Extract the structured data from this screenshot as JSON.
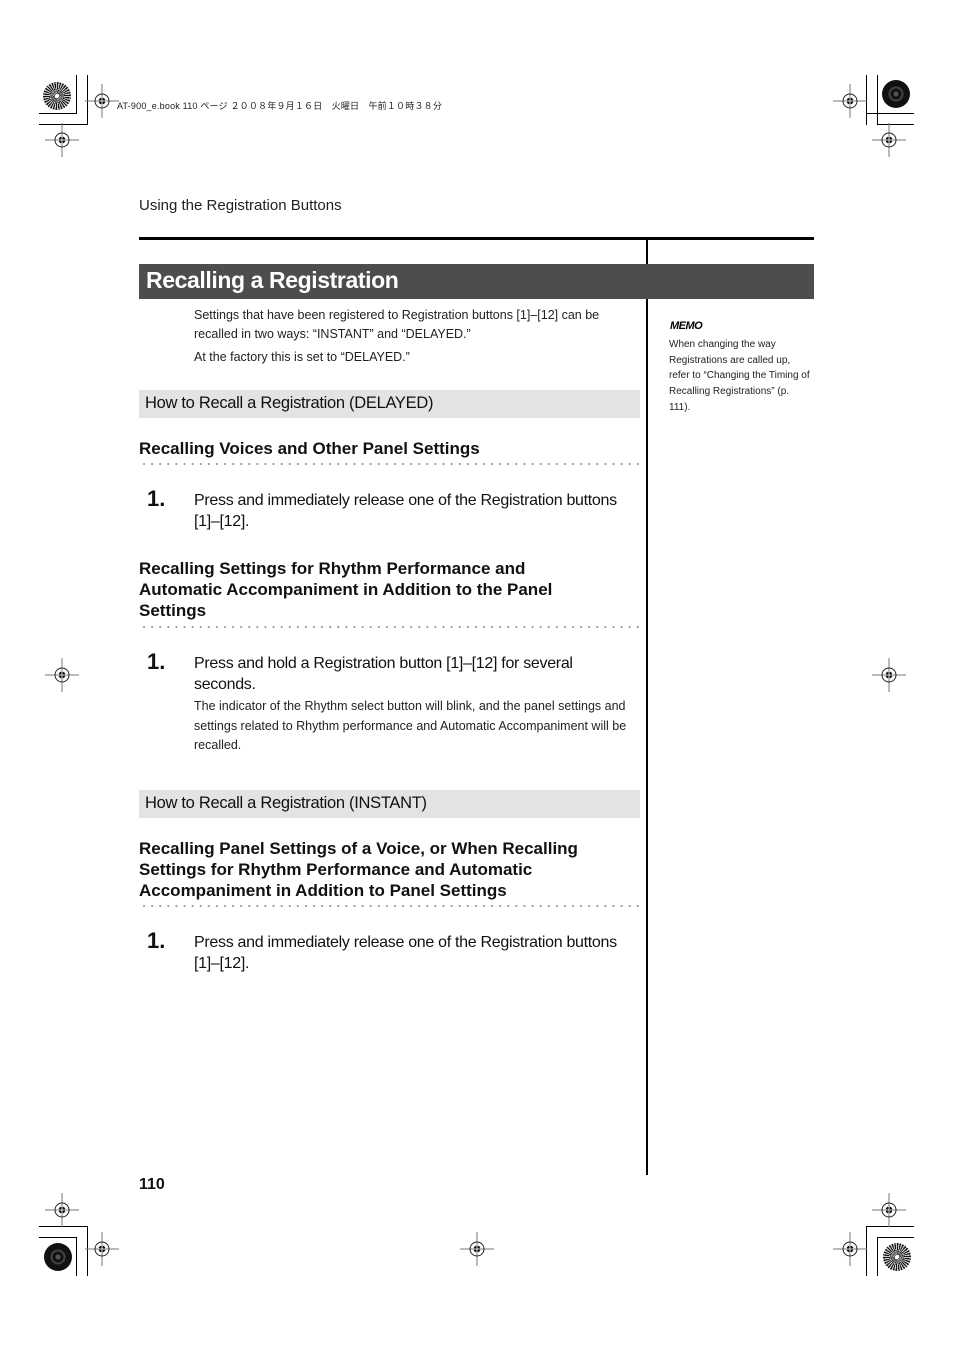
{
  "print_info": {
    "job_line": "AT-900_e.book  110 ページ  ２００８年９月１６日　火曜日　午前１０時３８分"
  },
  "running_head": "Using the Registration Buttons",
  "title": "Recalling a Registration",
  "intro": {
    "paragraph1": "Settings that have been registered to Registration buttons [1]–[12] can be recalled in two ways: “INSTANT” and “DELAYED.”",
    "paragraph2": "At the factory this is set to “DELAYED.”"
  },
  "memo": {
    "icon_label": "MEMO",
    "text": "When changing the way Registrations are called up, refer to “Changing the Timing of Recalling Registrations” (p. 111)."
  },
  "sections": [
    {
      "subhead": "How to Recall a Registration (DELAYED)",
      "groups": [
        {
          "heading": "Recalling Voices and Other Panel Settings",
          "step_number": "1.",
          "step_text": "Press and immediately release one of the Registration buttons [1]–[12].",
          "note": ""
        },
        {
          "heading": "Recalling Settings for Rhythm Performance and Automatic Accompaniment in Addition to the Panel Settings",
          "step_number": "1.",
          "step_text": "Press and hold a Registration button [1]–[12] for several seconds.",
          "note": "The indicator of the Rhythm select button will blink, and the panel settings and settings related to Rhythm performance and Automatic Accompaniment will be recalled."
        }
      ]
    },
    {
      "subhead": "How to Recall a Registration (INSTANT)",
      "groups": [
        {
          "heading": "Recalling Panel Settings of a Voice, or When Recalling Settings for Rhythm Performance and Automatic Accompaniment in Addition to Panel Settings",
          "step_number": "1.",
          "step_text": "Press and immediately release one of the Registration buttons [1]–[12].",
          "note": ""
        }
      ]
    }
  ],
  "page_number": "110"
}
